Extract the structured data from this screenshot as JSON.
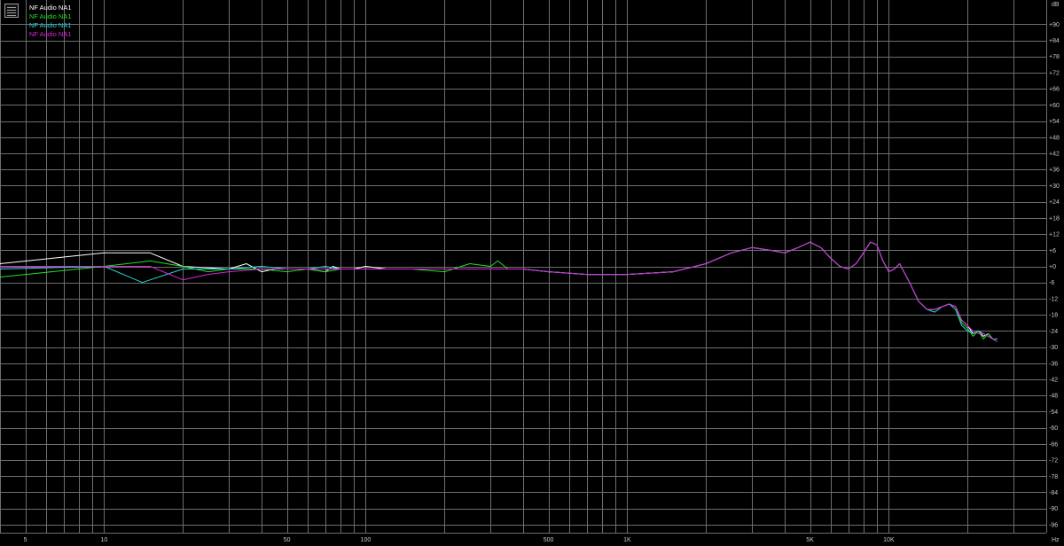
{
  "window": {
    "background": "#000000",
    "grid_color": "#6e6e6e",
    "axis_text_color": "#c8c8c8"
  },
  "legend": {
    "icon": "graph-settings-icon",
    "entries": [
      {
        "label": "NF Audio NA1",
        "color": "#ffffff"
      },
      {
        "label": "NF Audio NA1",
        "color": "#22e022"
      },
      {
        "label": "NF Audio NA1",
        "color": "#2ad3d3"
      },
      {
        "label": "NF Audio NA1",
        "color": "#dd22dd"
      }
    ]
  },
  "chart_data": {
    "type": "line",
    "x_scale": "log",
    "xlim": [
      4,
      40000
    ],
    "ylim": [
      -99,
      99
    ],
    "y_unit": "dB",
    "x_unit": "Hz",
    "grid": true,
    "legend_position": "top-left",
    "y_ticks": [
      90,
      84,
      78,
      72,
      66,
      60,
      54,
      48,
      42,
      36,
      30,
      24,
      18,
      12,
      6,
      0,
      -6,
      -12,
      -18,
      -24,
      -30,
      -36,
      -42,
      -48,
      -54,
      -60,
      -66,
      -72,
      -78,
      -84,
      -90,
      -96
    ],
    "y_tick_labels": [
      "+90",
      "+84",
      "+78",
      "+72",
      "+66",
      "+60",
      "+54",
      "+48",
      "+42",
      "+36",
      "+30",
      "+24",
      "+18",
      "+12",
      "+6",
      "+0",
      "-6",
      "-12",
      "-18",
      "-24",
      "-30",
      "-36",
      "-42",
      "-48",
      "-54",
      "-60",
      "-66",
      "-72",
      "-78",
      "-84",
      "-90",
      "-96"
    ],
    "x_ticks": [
      5,
      10,
      50,
      100,
      500,
      1000,
      5000,
      10000
    ],
    "x_tick_labels": [
      "5",
      "10",
      "50",
      "100",
      "500",
      "1K",
      "5K",
      "10K"
    ],
    "series": [
      {
        "name": "NF Audio NA1",
        "color": "#ffffff",
        "x": [
          4,
          10,
          15,
          20,
          30,
          35,
          40,
          45,
          50,
          60,
          70,
          75,
          80,
          90,
          100,
          120,
          150,
          200,
          250,
          300,
          400,
          500,
          700,
          1000,
          1500,
          2000,
          2500,
          3000,
          3500,
          4000,
          4500,
          5000,
          5500,
          6000,
          6500,
          7000,
          7500,
          8000,
          8500,
          9000,
          9500,
          10000,
          10500,
          11000,
          12000,
          13000,
          14000,
          15000,
          16000,
          17000,
          18000,
          19000,
          20000,
          21000,
          22000,
          23000,
          24000,
          25000,
          26000
        ],
        "y": [
          1,
          5,
          5,
          0,
          -1,
          1,
          -2,
          -1,
          -1,
          -1,
          -2,
          0,
          -1,
          -1,
          0,
          -1,
          -1,
          -1,
          -1,
          -1,
          -1,
          -2,
          -3,
          -3,
          -2,
          1,
          5,
          7,
          6,
          5,
          7,
          9,
          7,
          3,
          0,
          -1,
          1,
          5,
          9,
          8,
          2,
          -2,
          -1,
          1,
          -6,
          -13,
          -16,
          -16,
          -15,
          -14,
          -15,
          -20,
          -22,
          -25,
          -24,
          -26,
          -25,
          -27,
          -27
        ]
      },
      {
        "name": "NF Audio NA1",
        "color": "#22e022",
        "x": [
          4,
          10,
          15,
          20,
          25,
          30,
          40,
          50,
          60,
          70,
          80,
          90,
          100,
          120,
          150,
          200,
          250,
          300,
          320,
          350,
          400,
          500,
          700,
          1000,
          1500,
          2000,
          2500,
          3000,
          3500,
          4000,
          4500,
          5000,
          5500,
          6000,
          6500,
          7000,
          7500,
          8000,
          8500,
          9000,
          9500,
          10000,
          10500,
          11000,
          12000,
          13000,
          14000,
          15000,
          16000,
          17000,
          18000,
          19000,
          20000,
          21000,
          22000,
          23000,
          24000,
          25000,
          26000
        ],
        "y": [
          -4,
          0,
          2,
          0,
          -2,
          -1,
          -1,
          -2,
          -1,
          -2,
          -1,
          -1,
          -1,
          -1,
          -1,
          -2,
          1,
          0,
          2,
          -1,
          -1,
          -2,
          -3,
          -3,
          -2,
          1,
          5,
          7,
          6,
          5,
          7,
          9,
          7,
          3,
          0,
          -1,
          1,
          5,
          9,
          8,
          2,
          -2,
          -1,
          1,
          -6,
          -13,
          -16,
          -16,
          -15,
          -14,
          -15,
          -21,
          -23,
          -26,
          -24,
          -27,
          -25,
          -27,
          -28
        ]
      },
      {
        "name": "NF Audio NA1",
        "color": "#2ad3d3",
        "x": [
          4,
          10,
          14,
          20,
          25,
          30,
          40,
          50,
          60,
          70,
          80,
          90,
          100,
          120,
          150,
          200,
          250,
          300,
          400,
          500,
          700,
          1000,
          1500,
          2000,
          2500,
          3000,
          3500,
          4000,
          4500,
          5000,
          5500,
          6000,
          6500,
          7000,
          7500,
          8000,
          8500,
          9000,
          9500,
          10000,
          10500,
          11000,
          12000,
          13000,
          14000,
          15000,
          16000,
          17000,
          18000,
          19000,
          20000,
          21000,
          22000,
          23000,
          24000,
          25000,
          26000
        ],
        "y": [
          -1,
          0,
          -6,
          -1,
          -1,
          -1,
          0,
          -1,
          -1,
          0,
          -1,
          -1,
          -1,
          -1,
          -1,
          -1,
          -1,
          -1,
          -1,
          -2,
          -3,
          -3,
          -2,
          1,
          5,
          7,
          6,
          5,
          7,
          9,
          7,
          3,
          0,
          -1,
          1,
          5,
          9,
          8,
          2,
          -2,
          -1,
          1,
          -6,
          -13,
          -16,
          -17,
          -15,
          -14,
          -16,
          -22,
          -24,
          -25,
          -24,
          -25,
          -26,
          -27,
          -27
        ]
      },
      {
        "name": "NF Audio NA1",
        "color": "#dd22dd",
        "x": [
          4,
          10,
          15,
          20,
          25,
          30,
          40,
          50,
          60,
          70,
          80,
          100,
          120,
          150,
          200,
          250,
          300,
          400,
          500,
          700,
          1000,
          1500,
          2000,
          2500,
          3000,
          3500,
          4000,
          4500,
          5000,
          5500,
          6000,
          6500,
          7000,
          7500,
          8000,
          8500,
          9000,
          9500,
          10000,
          10500,
          11000,
          12000,
          13000,
          14000,
          15000,
          16000,
          17000,
          18000,
          19000,
          20000,
          21000,
          22000,
          23000,
          24000,
          25000,
          26000
        ],
        "y": [
          0,
          0,
          0,
          -5,
          -3,
          -2,
          -1,
          -1,
          -1,
          -1,
          -1,
          -1,
          -1,
          -1,
          -1,
          -1,
          -1,
          -1,
          -2,
          -3,
          -3,
          -2,
          1,
          5,
          7,
          6,
          5,
          7,
          9,
          7,
          3,
          0,
          -1,
          1,
          5,
          9,
          8,
          2,
          -2,
          -1,
          1,
          -6,
          -13,
          -16,
          -16,
          -15,
          -14,
          -15,
          -20,
          -22,
          -24,
          -25,
          -25,
          -26,
          -27,
          -28
        ]
      }
    ]
  }
}
